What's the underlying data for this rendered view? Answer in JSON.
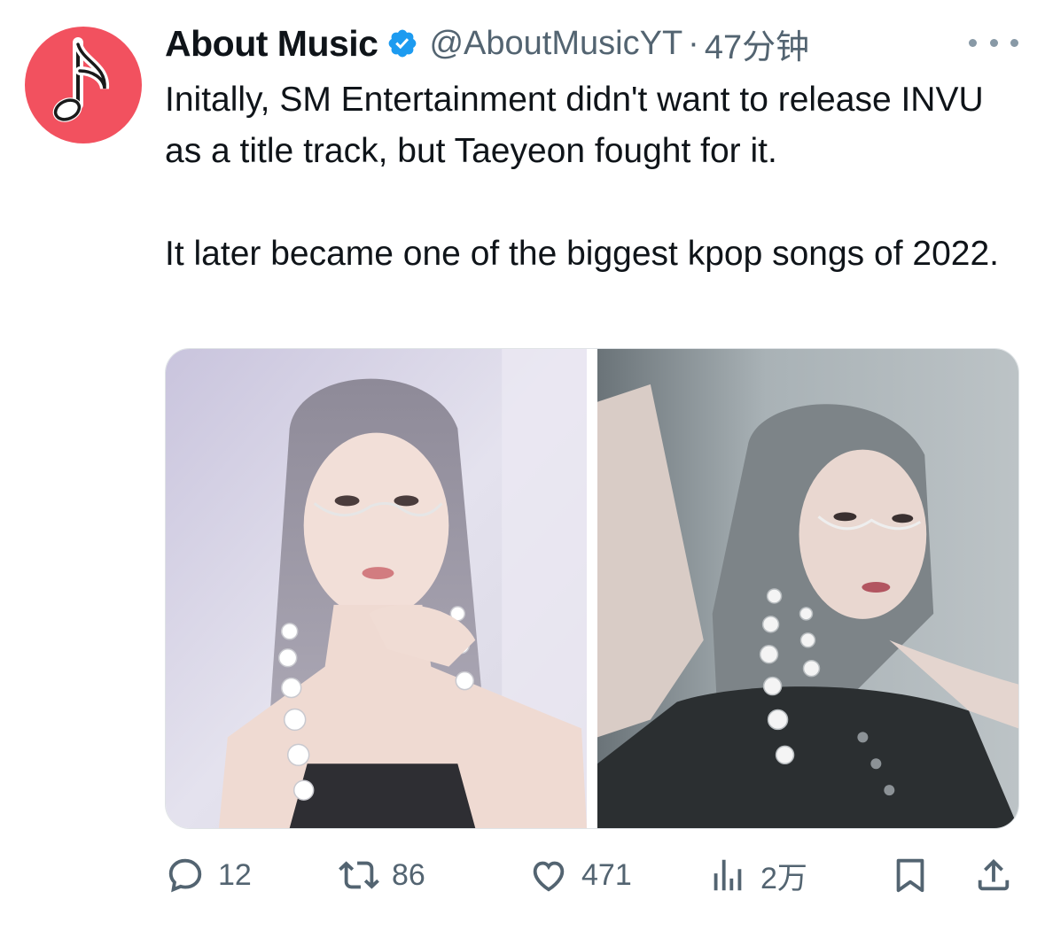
{
  "tweet": {
    "display_name": "About Music",
    "handle": "@AboutMusicYT",
    "separator": "·",
    "time": "47分钟",
    "verified": true,
    "avatar_icon": "music-note-icon",
    "avatar_color": "#f2515f",
    "text_paragraphs": [
      "Initally, SM Entertainment didn't want to release INVU as a title track, but Taeyeon fought for it.",
      "It later became one of the biggest kpop songs of 2022."
    ],
    "media": [
      {
        "icon": "photo-left"
      },
      {
        "icon": "photo-right"
      }
    ]
  },
  "actions": {
    "reply": {
      "icon": "reply-icon",
      "count": "12"
    },
    "retweet": {
      "icon": "retweet-icon",
      "count": "86"
    },
    "like": {
      "icon": "heart-icon",
      "count": "471"
    },
    "views": {
      "icon": "views-chart-icon",
      "count": "2万"
    },
    "bookmark": {
      "icon": "bookmark-icon"
    },
    "share": {
      "icon": "share-icon"
    }
  },
  "colors": {
    "text": "#0f1419",
    "secondary": "#536471",
    "verified_blue": "#1d9bf0"
  }
}
